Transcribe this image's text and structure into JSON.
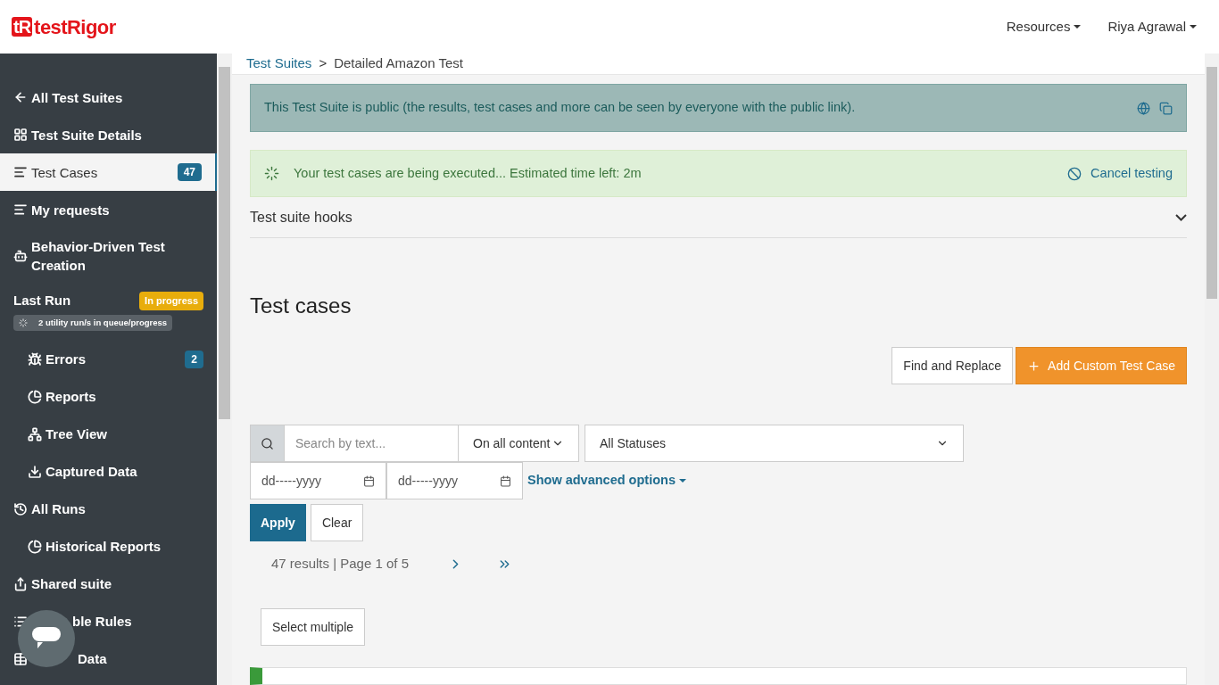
{
  "header": {
    "logo_mark": "tR",
    "logo_text": "testRigor",
    "menus": [
      {
        "label": "Resources"
      },
      {
        "label": "Riya Agrawal"
      }
    ]
  },
  "sidebar": {
    "items": [
      {
        "kind": "back",
        "label": "All Test Suites",
        "selected": false
      },
      {
        "kind": "link",
        "label": "Test Suite Details",
        "selected": false
      },
      {
        "kind": "link",
        "label": "Test Cases",
        "badge": "47",
        "selected": true
      },
      {
        "kind": "link",
        "label": "My requests",
        "selected": false
      },
      {
        "kind": "link",
        "label": "Behavior-Driven Test Creation",
        "selected": false
      },
      {
        "kind": "section",
        "label": "Last Run",
        "status": "In progress",
        "note": "2 utility run/s in queue/progress",
        "selected": false
      },
      {
        "kind": "sub",
        "label": "Errors",
        "badge": "2",
        "selected": false
      },
      {
        "kind": "sub",
        "label": "Reports",
        "selected": false
      },
      {
        "kind": "sub",
        "label": "Tree View",
        "selected": false
      },
      {
        "kind": "sub",
        "label": "Captured Data",
        "selected": false
      },
      {
        "kind": "link",
        "label": "All Runs",
        "selected": false
      },
      {
        "kind": "sub",
        "label": "Historical Reports",
        "selected": false
      },
      {
        "kind": "link",
        "label": "Shared suite",
        "selected": false
      },
      {
        "kind": "covered",
        "label": "ble Rules",
        "selected": false
      },
      {
        "kind": "covered2",
        "label": "Data",
        "selected": false
      }
    ]
  },
  "breadcrumb": [
    {
      "label": "Test Suites",
      "link": true
    },
    {
      "label": "Detailed Amazon Test",
      "link": false
    }
  ],
  "breadcrumb_separator": ">",
  "public_notice": "This Test Suite is public (the results, test cases and more can be seen by everyone with the public link).",
  "progress_notice": {
    "text": "Your test cases are being executed... Estimated time left: 2m",
    "action": "Cancel testing"
  },
  "hooks": {
    "label": "Test suite hooks",
    "expanded": false
  },
  "title": "Test cases",
  "actions": [
    {
      "kind": "plain",
      "label": "Find and Replace"
    },
    {
      "kind": "primary",
      "label": "Add Custom Test Case"
    }
  ],
  "filters": {
    "search_placeholder": "Search by text...",
    "scope": "On all content",
    "status": "All Statuses",
    "date_from": "dd-----yyyy",
    "date_to": "dd-----yyyy",
    "advanced": "Show advanced options",
    "apply": "Apply",
    "clear": "Clear"
  },
  "pagination": {
    "summary": "47 results | Page 1 of 5"
  },
  "select_multiple": "Select multiple"
}
